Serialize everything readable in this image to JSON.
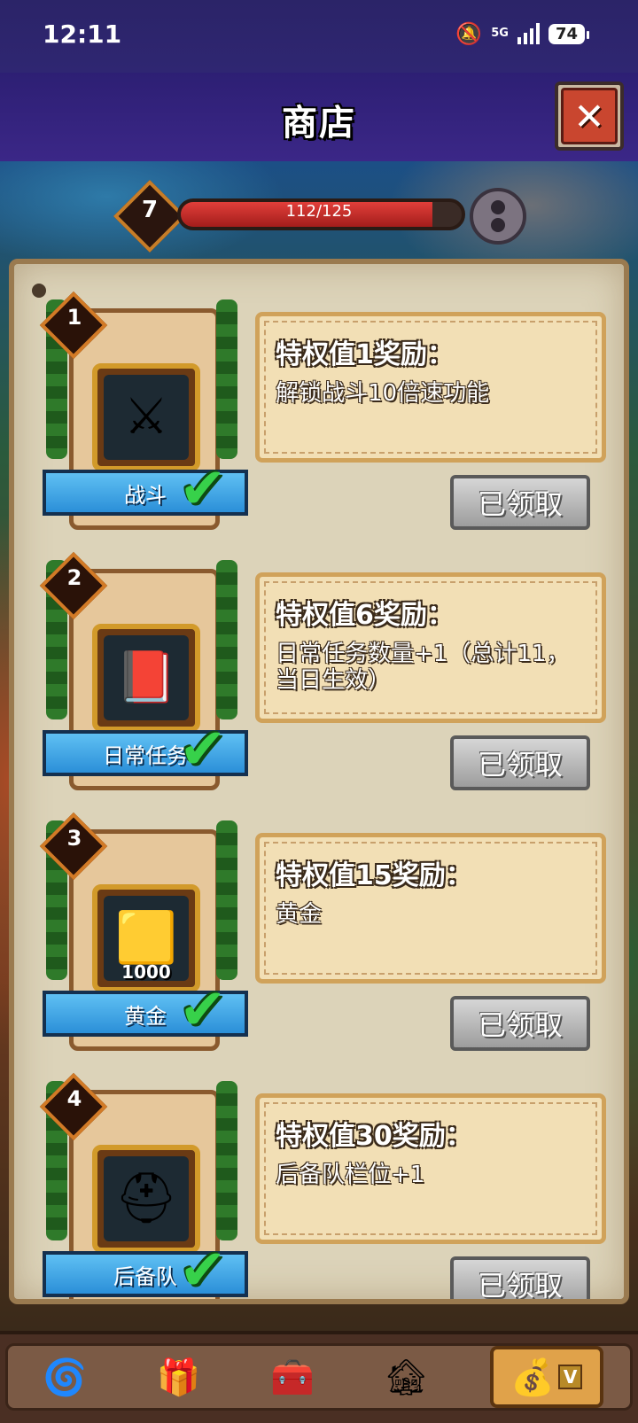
{
  "status_bar": {
    "time": "12:11",
    "network": "5G",
    "battery": "74"
  },
  "header": {
    "title": "商店"
  },
  "level": {
    "value": "7",
    "xp_text": "112/125",
    "xp_fraction": 0.896
  },
  "rewards": [
    {
      "index": "1",
      "name": "战斗",
      "icon": "crossed-swords-icon",
      "qty": "",
      "title": "特权值1奖励：",
      "desc": "解锁战斗10倍速功能",
      "button": "已领取"
    },
    {
      "index": "2",
      "name": "日常任务",
      "icon": "book-icon",
      "qty": "",
      "title": "特权值6奖励：",
      "desc": "日常任务数量+1（总计11，当日生效）",
      "button": "已领取"
    },
    {
      "index": "3",
      "name": "黄金",
      "icon": "gold-bar-icon",
      "qty": "1000",
      "title": "特权值15奖励：",
      "desc": "黄金",
      "button": "已领取"
    },
    {
      "index": "4",
      "name": "后备队",
      "icon": "helmet-icon",
      "qty": "",
      "title": "特权值30奖励：",
      "desc": "后备队栏位+1",
      "button": "已领取"
    }
  ],
  "nav": {
    "active_badge": "V",
    "items": [
      "card-icon",
      "gift-icon",
      "chest-icon",
      "hall-icon",
      "gold-bag-icon"
    ]
  },
  "colors": {
    "header": "#2d1f74",
    "xp_fill": "#e23f3a",
    "ribbon": "#2b8fd8",
    "check": "#37d14a"
  }
}
